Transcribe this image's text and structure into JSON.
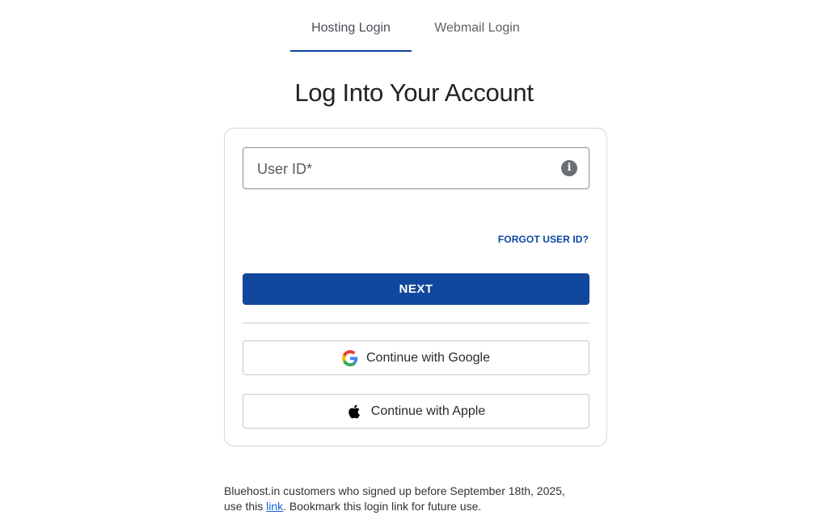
{
  "tabs": {
    "hosting_label": "Hosting Login",
    "webmail_label": "Webmail Login",
    "active": "Hosting Login"
  },
  "page": {
    "title": "Log Into Your Account"
  },
  "form": {
    "userid_placeholder": "User ID*",
    "forgot_label": "FORGOT USER ID?",
    "next_label": "NEXT",
    "google_label": "Continue with Google",
    "apple_label": "Continue with Apple"
  },
  "footer": {
    "line1": "Bluehost.in customers who signed up before September 18th, 2025,",
    "line2_prefix": "use this ",
    "link_label": "link",
    "line2_suffix": ". Bookmark this login link for future use."
  },
  "colors": {
    "accent": "#11489d",
    "link": "#0d47a1",
    "footer_link": "#1a63d6"
  },
  "icons": {
    "info": "info-icon",
    "google": "google-icon",
    "apple": "apple-icon"
  }
}
